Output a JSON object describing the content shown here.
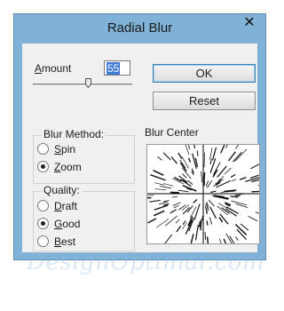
{
  "window": {
    "title": "Radial Blur",
    "close_glyph": "✕"
  },
  "amount": {
    "label_first": "A",
    "label_rest": "mount",
    "value": "55"
  },
  "buttons": {
    "ok": "OK",
    "reset": "Reset"
  },
  "blur_method": {
    "legend": "Blur Method:",
    "options": [
      {
        "hotkey": "S",
        "rest": "pin",
        "selected": false
      },
      {
        "hotkey": "Z",
        "rest": "oom",
        "selected": true
      }
    ]
  },
  "quality": {
    "legend": "Quality:",
    "options": [
      {
        "hotkey": "D",
        "rest": "raft",
        "selected": false
      },
      {
        "hotkey": "G",
        "rest": "ood",
        "selected": true
      },
      {
        "hotkey": "B",
        "rest": "est",
        "selected": false
      }
    ]
  },
  "blur_center": {
    "label": "Blur Center"
  },
  "watermark": {
    "text": "DesignOptimal.com"
  },
  "colors": {
    "titlebar": "#7fb2d6",
    "selection": "#3d7bd6"
  }
}
